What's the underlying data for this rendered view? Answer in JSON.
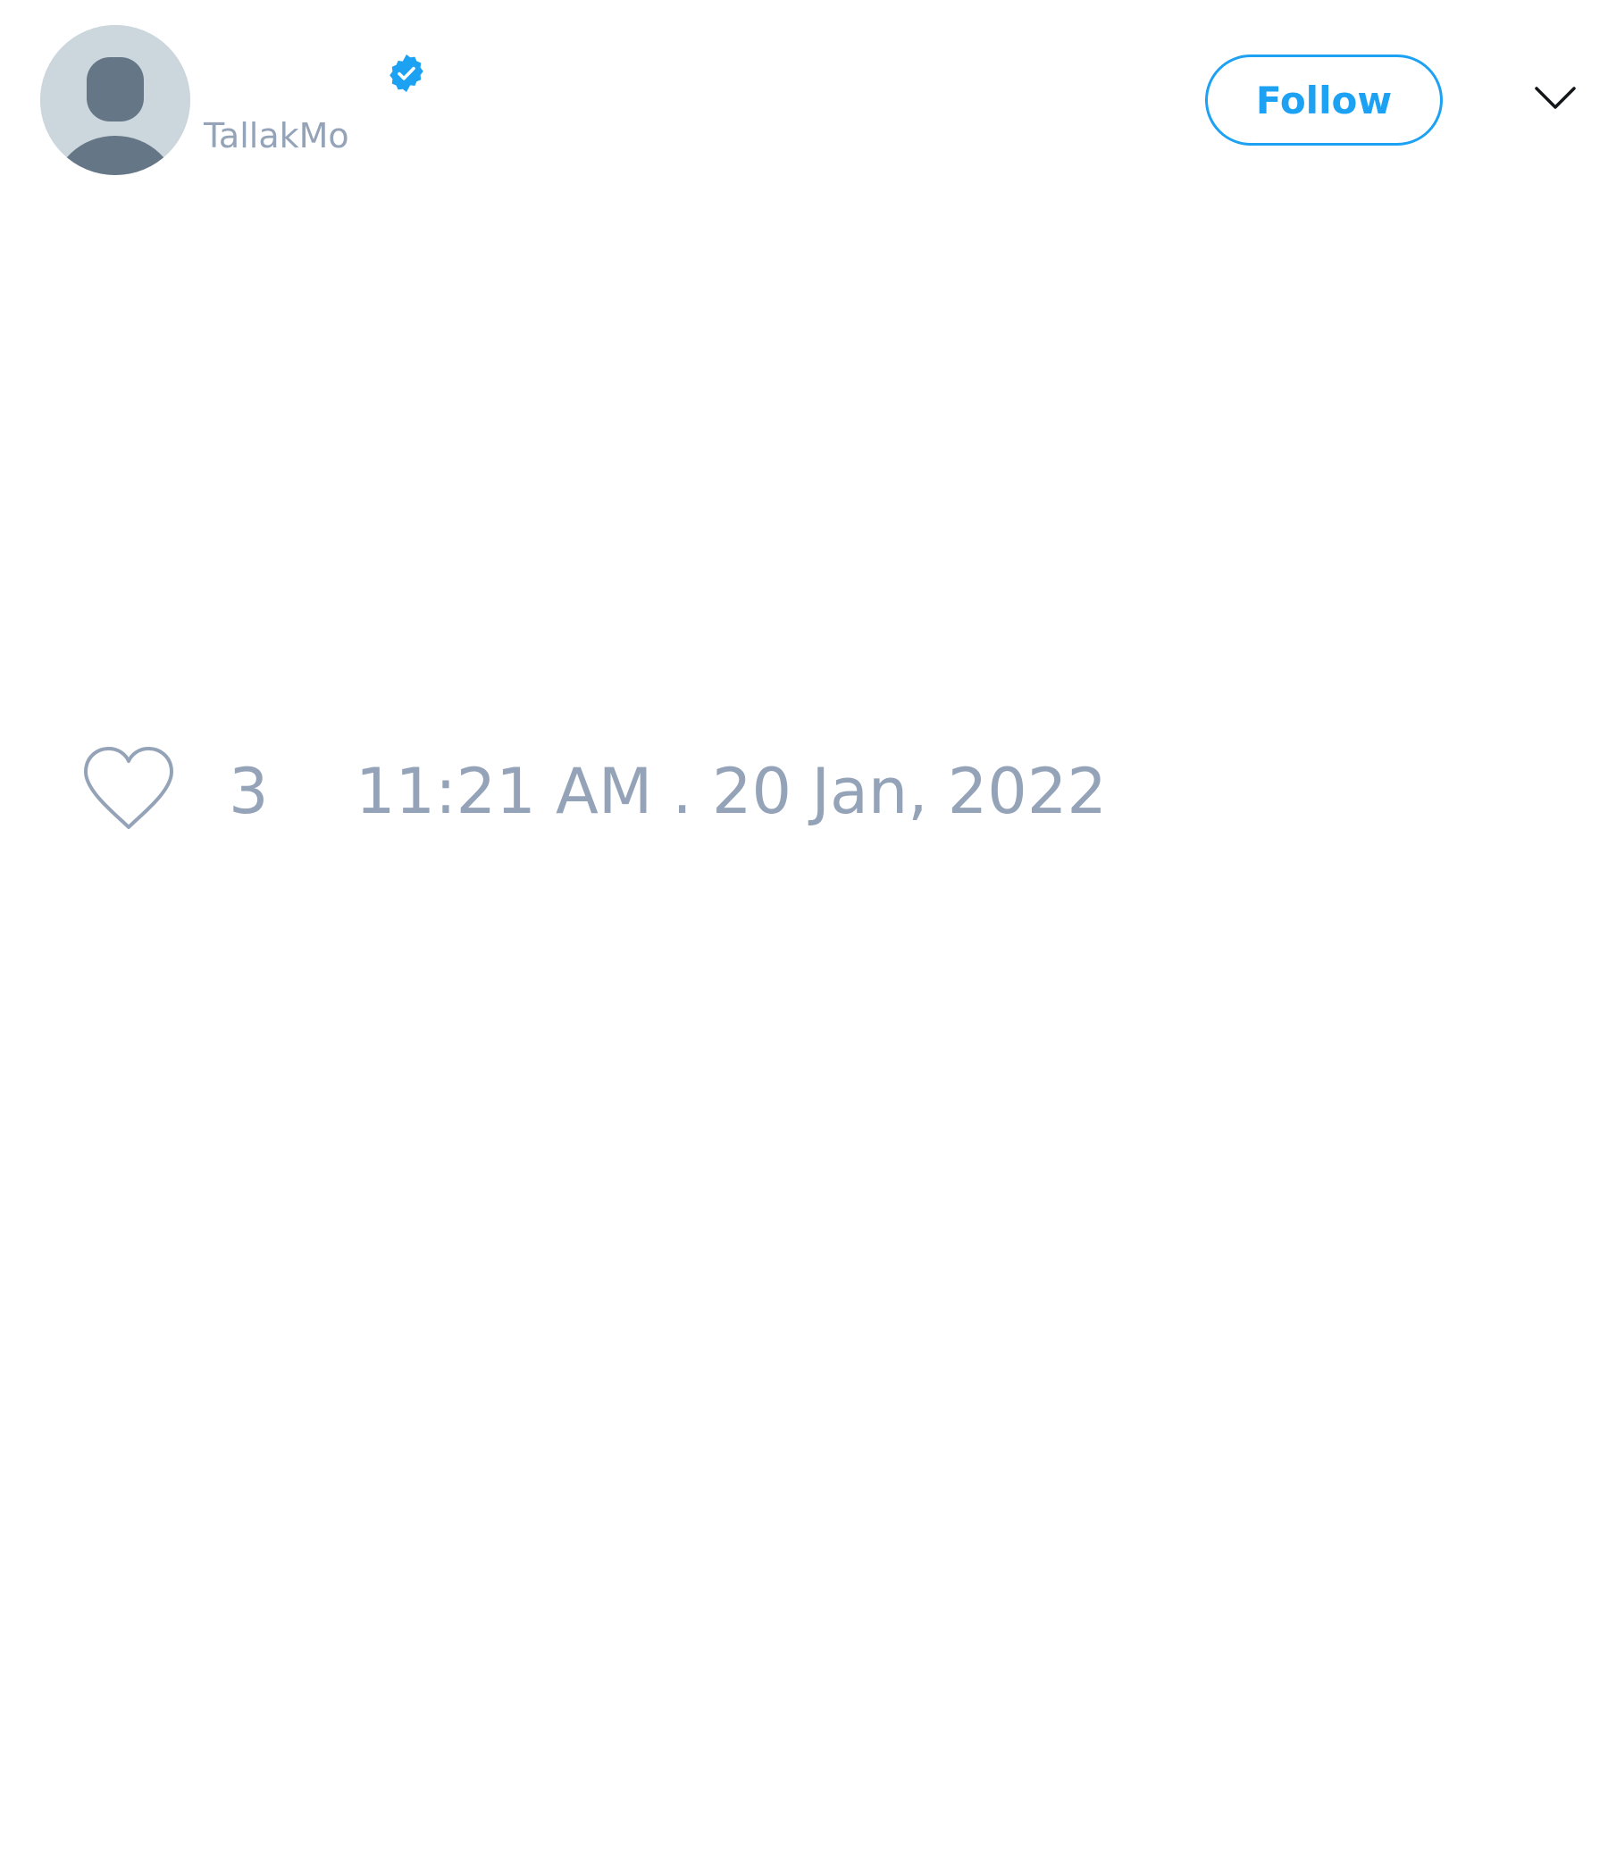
{
  "tweet": {
    "author": {
      "display_name": "",
      "username": "TallakMo",
      "verified": true,
      "avatar_icon": "default-avatar-icon",
      "verified_icon": "verified-badge-icon"
    },
    "follow_button": {
      "label": "Follow"
    },
    "menu_icon": "chevron-down-icon",
    "likes": {
      "icon": "heart-icon",
      "count": "3"
    },
    "timestamp": "11:21 AM . 20 Jan, 2022"
  },
  "colors": {
    "accent": "#1da1f2",
    "muted_text": "#94a3b8",
    "avatar_bg": "#ccd6dd",
    "avatar_figure": "#657786",
    "icon_dark": "#14171a"
  }
}
